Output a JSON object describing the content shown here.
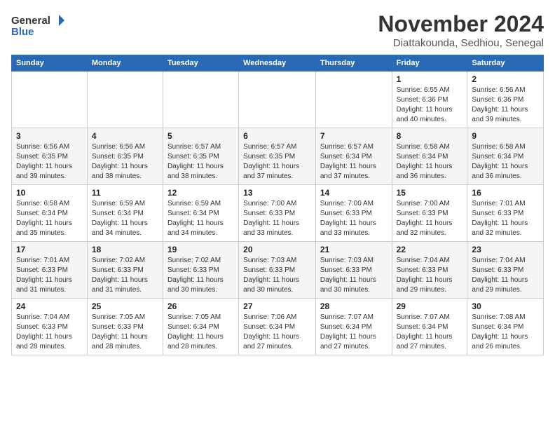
{
  "header": {
    "logo_line1": "General",
    "logo_line2": "Blue",
    "month": "November 2024",
    "location": "Diattakounda, Sedhiou, Senegal"
  },
  "weekdays": [
    "Sunday",
    "Monday",
    "Tuesday",
    "Wednesday",
    "Thursday",
    "Friday",
    "Saturday"
  ],
  "weeks": [
    [
      {
        "day": "",
        "info": ""
      },
      {
        "day": "",
        "info": ""
      },
      {
        "day": "",
        "info": ""
      },
      {
        "day": "",
        "info": ""
      },
      {
        "day": "",
        "info": ""
      },
      {
        "day": "1",
        "info": "Sunrise: 6:55 AM\nSunset: 6:36 PM\nDaylight: 11 hours and 40 minutes."
      },
      {
        "day": "2",
        "info": "Sunrise: 6:56 AM\nSunset: 6:36 PM\nDaylight: 11 hours and 39 minutes."
      }
    ],
    [
      {
        "day": "3",
        "info": "Sunrise: 6:56 AM\nSunset: 6:35 PM\nDaylight: 11 hours and 39 minutes."
      },
      {
        "day": "4",
        "info": "Sunrise: 6:56 AM\nSunset: 6:35 PM\nDaylight: 11 hours and 38 minutes."
      },
      {
        "day": "5",
        "info": "Sunrise: 6:57 AM\nSunset: 6:35 PM\nDaylight: 11 hours and 38 minutes."
      },
      {
        "day": "6",
        "info": "Sunrise: 6:57 AM\nSunset: 6:35 PM\nDaylight: 11 hours and 37 minutes."
      },
      {
        "day": "7",
        "info": "Sunrise: 6:57 AM\nSunset: 6:34 PM\nDaylight: 11 hours and 37 minutes."
      },
      {
        "day": "8",
        "info": "Sunrise: 6:58 AM\nSunset: 6:34 PM\nDaylight: 11 hours and 36 minutes."
      },
      {
        "day": "9",
        "info": "Sunrise: 6:58 AM\nSunset: 6:34 PM\nDaylight: 11 hours and 36 minutes."
      }
    ],
    [
      {
        "day": "10",
        "info": "Sunrise: 6:58 AM\nSunset: 6:34 PM\nDaylight: 11 hours and 35 minutes."
      },
      {
        "day": "11",
        "info": "Sunrise: 6:59 AM\nSunset: 6:34 PM\nDaylight: 11 hours and 34 minutes."
      },
      {
        "day": "12",
        "info": "Sunrise: 6:59 AM\nSunset: 6:34 PM\nDaylight: 11 hours and 34 minutes."
      },
      {
        "day": "13",
        "info": "Sunrise: 7:00 AM\nSunset: 6:33 PM\nDaylight: 11 hours and 33 minutes."
      },
      {
        "day": "14",
        "info": "Sunrise: 7:00 AM\nSunset: 6:33 PM\nDaylight: 11 hours and 33 minutes."
      },
      {
        "day": "15",
        "info": "Sunrise: 7:00 AM\nSunset: 6:33 PM\nDaylight: 11 hours and 32 minutes."
      },
      {
        "day": "16",
        "info": "Sunrise: 7:01 AM\nSunset: 6:33 PM\nDaylight: 11 hours and 32 minutes."
      }
    ],
    [
      {
        "day": "17",
        "info": "Sunrise: 7:01 AM\nSunset: 6:33 PM\nDaylight: 11 hours and 31 minutes."
      },
      {
        "day": "18",
        "info": "Sunrise: 7:02 AM\nSunset: 6:33 PM\nDaylight: 11 hours and 31 minutes."
      },
      {
        "day": "19",
        "info": "Sunrise: 7:02 AM\nSunset: 6:33 PM\nDaylight: 11 hours and 30 minutes."
      },
      {
        "day": "20",
        "info": "Sunrise: 7:03 AM\nSunset: 6:33 PM\nDaylight: 11 hours and 30 minutes."
      },
      {
        "day": "21",
        "info": "Sunrise: 7:03 AM\nSunset: 6:33 PM\nDaylight: 11 hours and 30 minutes."
      },
      {
        "day": "22",
        "info": "Sunrise: 7:04 AM\nSunset: 6:33 PM\nDaylight: 11 hours and 29 minutes."
      },
      {
        "day": "23",
        "info": "Sunrise: 7:04 AM\nSunset: 6:33 PM\nDaylight: 11 hours and 29 minutes."
      }
    ],
    [
      {
        "day": "24",
        "info": "Sunrise: 7:04 AM\nSunset: 6:33 PM\nDaylight: 11 hours and 28 minutes."
      },
      {
        "day": "25",
        "info": "Sunrise: 7:05 AM\nSunset: 6:33 PM\nDaylight: 11 hours and 28 minutes."
      },
      {
        "day": "26",
        "info": "Sunrise: 7:05 AM\nSunset: 6:34 PM\nDaylight: 11 hours and 28 minutes."
      },
      {
        "day": "27",
        "info": "Sunrise: 7:06 AM\nSunset: 6:34 PM\nDaylight: 11 hours and 27 minutes."
      },
      {
        "day": "28",
        "info": "Sunrise: 7:07 AM\nSunset: 6:34 PM\nDaylight: 11 hours and 27 minutes."
      },
      {
        "day": "29",
        "info": "Sunrise: 7:07 AM\nSunset: 6:34 PM\nDaylight: 11 hours and 27 minutes."
      },
      {
        "day": "30",
        "info": "Sunrise: 7:08 AM\nSunset: 6:34 PM\nDaylight: 11 hours and 26 minutes."
      }
    ]
  ]
}
